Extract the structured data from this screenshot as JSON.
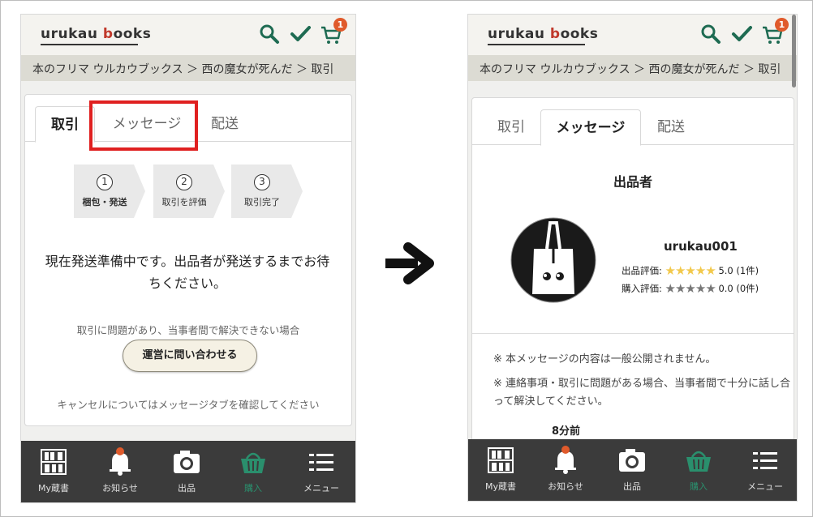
{
  "header": {
    "logo_a": "urukau ",
    "logo_b": "b",
    "logo_c": "ooks",
    "cart_count": "1"
  },
  "breadcrumb": "本のフリマ ウルカウブックス ＞ 西の魔女が死んだ ＞ 取引",
  "tabs": [
    {
      "label": "取引"
    },
    {
      "label": "メッセージ"
    },
    {
      "label": "配送"
    }
  ],
  "left": {
    "steps": [
      {
        "num": "1",
        "label": "梱包・発送"
      },
      {
        "num": "2",
        "label": "取引を評価"
      },
      {
        "num": "3",
        "label": "取引完了"
      }
    ],
    "status_message": "現在発送準備中です。出品者が発送するまでお待ちください。",
    "trouble_note": "取引に問題があり、当事者間で解決できない場合",
    "contact_button": "運営に問い合わせる",
    "cancel_note": "キャンセルについてはメッセージタブを確認してください"
  },
  "right": {
    "seller_title": "出品者",
    "username": "urukau001",
    "seller_rating_label": "出品評価:",
    "seller_rating_stars": "★★★★★",
    "seller_rating_value": "5.0 (1件)",
    "buyer_rating_label": "購入評価:",
    "buyer_rating_stars": "★★★★★",
    "buyer_rating_value": "0.0 (0件)",
    "notice1": "※ 本メッセージの内容は一般公開されません。",
    "notice2": "※ 連絡事項・取引に問題がある場合、当事者間で十分に話し合って解決してください。",
    "time": "8分前"
  },
  "nav": [
    {
      "label": "My蔵書",
      "icon": "bookshelf-icon"
    },
    {
      "label": "お知らせ",
      "icon": "bell-icon"
    },
    {
      "label": "出品",
      "icon": "camera-icon"
    },
    {
      "label": "購入",
      "icon": "basket-icon"
    },
    {
      "label": "メニュー",
      "icon": "menu-icon"
    }
  ],
  "colors": {
    "accent_green": "#2a8f6d",
    "highlight_red": "#e02020",
    "star_yellow": "#f2c94c",
    "nav_bg": "#3b3b3b"
  }
}
